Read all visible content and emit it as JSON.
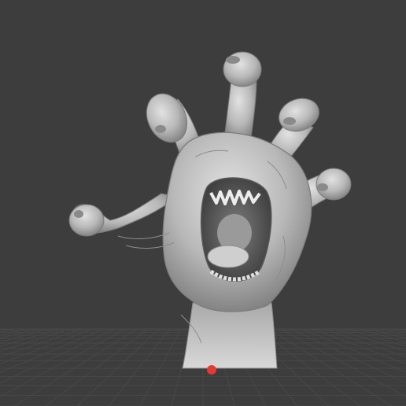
{
  "viewport": {
    "background_color": "#3d3d3d",
    "grid_color": "#4a4a4a",
    "model_color": "#bdbdbd",
    "model_shadow_color": "#6e6e6e",
    "origin_marker_color": "#e53935"
  },
  "model": {
    "icon": "sculpted-hand-mouth-model-icon"
  }
}
